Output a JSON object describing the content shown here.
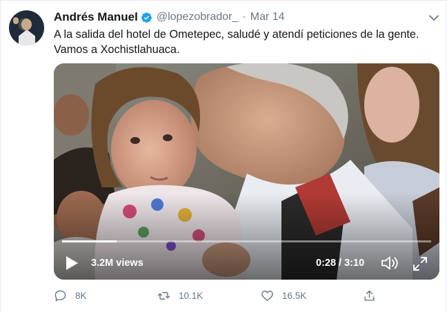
{
  "tweet": {
    "author_name": "Andrés Manuel",
    "handle": "@lopezobrador_",
    "separator": "·",
    "date": "Mar 14",
    "text_line1": "A la salida del hotel de Ometepec, saludé y atendí peticiones de la gente.",
    "text_line2": "Vamos a Xochistlahuaca.",
    "verified": true
  },
  "video": {
    "views": "3.2M views",
    "time": "0:28 / 3:10",
    "progress": 0.148
  },
  "actions": {
    "replies": "8K",
    "retweets": "10.1K",
    "likes": "16.5K"
  },
  "colors": {
    "verified_blue": "#1da1f2",
    "muted_text": "#657786",
    "primary_text": "#14171a"
  }
}
